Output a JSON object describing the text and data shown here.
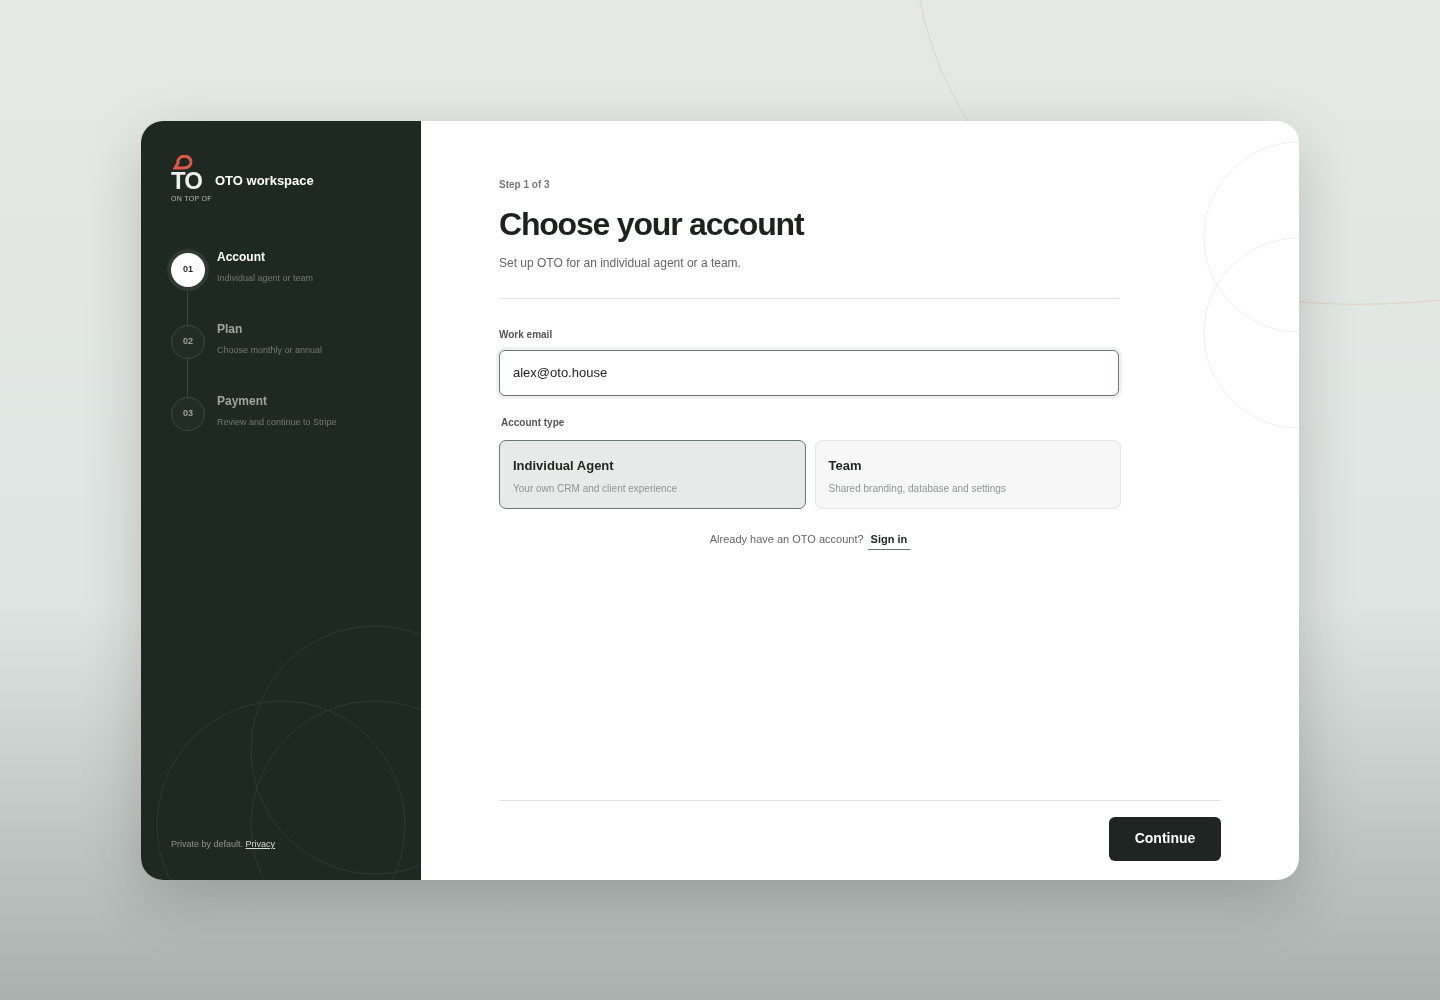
{
  "sidebar": {
    "logo": {
      "letters": "TO",
      "tagline": "ON TOP OF"
    },
    "title": "OTO workspace",
    "steps": [
      {
        "number": "01",
        "title": "Account",
        "subtitle": "Individual agent or team",
        "selected": true
      },
      {
        "number": "02",
        "title": "Plan",
        "subtitle": "Choose monthly or annual",
        "selected": false
      },
      {
        "number": "03",
        "title": "Payment",
        "subtitle": "Review and continue to Stripe",
        "selected": false
      }
    ],
    "footer": {
      "text": "Private by default.",
      "link": "Privacy"
    }
  },
  "main": {
    "step_label": "Step 1 of 3",
    "heading": "Choose your account",
    "subheading": "Set up OTO for an individual agent or a team.",
    "email": {
      "label": "Work email",
      "value": "alex@oto.house"
    },
    "account_type": {
      "label": "Account type",
      "options": [
        {
          "title": "Individual Agent",
          "description": "Your own CRM and client experience",
          "selected": true
        },
        {
          "title": "Team",
          "description": "Shared branding, database and settings",
          "selected": false
        }
      ]
    },
    "signin": {
      "text": "Already have an OTO account?",
      "link": "Sign in"
    },
    "continue_button": "Continue"
  }
}
